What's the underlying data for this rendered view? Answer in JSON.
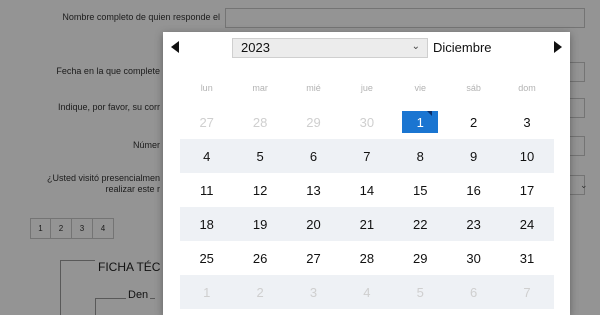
{
  "form": {
    "q1_label": "Nombre completo de quien responde el",
    "q2_label": "Fecha en la que complete",
    "q3_label": "Indique, por favor, su corr",
    "q4_label": "Númer",
    "q5_label_line1": "¿Usted visitó presencialmen",
    "q5_label_line2": "realizar este r",
    "tabs": [
      "1",
      "2",
      "3",
      "4"
    ],
    "ficha_title": "FICHA TÉC",
    "den_label": "Den"
  },
  "datepicker": {
    "year": "2023",
    "month": "Diciembre",
    "weekdays": [
      "lun",
      "mar",
      "mié",
      "jue",
      "vie",
      "sáb",
      "dom"
    ],
    "weeks": [
      [
        {
          "d": "27",
          "o": true
        },
        {
          "d": "28",
          "o": true
        },
        {
          "d": "29",
          "o": true
        },
        {
          "d": "30",
          "o": true
        },
        {
          "d": "1",
          "o": false,
          "sel": true
        },
        {
          "d": "2",
          "o": false
        },
        {
          "d": "3",
          "o": false
        }
      ],
      [
        {
          "d": "4",
          "o": false
        },
        {
          "d": "5",
          "o": false
        },
        {
          "d": "6",
          "o": false
        },
        {
          "d": "7",
          "o": false
        },
        {
          "d": "8",
          "o": false
        },
        {
          "d": "9",
          "o": false
        },
        {
          "d": "10",
          "o": false
        }
      ],
      [
        {
          "d": "11",
          "o": false
        },
        {
          "d": "12",
          "o": false
        },
        {
          "d": "13",
          "o": false
        },
        {
          "d": "14",
          "o": false
        },
        {
          "d": "15",
          "o": false
        },
        {
          "d": "16",
          "o": false
        },
        {
          "d": "17",
          "o": false
        }
      ],
      [
        {
          "d": "18",
          "o": false
        },
        {
          "d": "19",
          "o": false
        },
        {
          "d": "20",
          "o": false
        },
        {
          "d": "21",
          "o": false
        },
        {
          "d": "22",
          "o": false
        },
        {
          "d": "23",
          "o": false
        },
        {
          "d": "24",
          "o": false
        }
      ],
      [
        {
          "d": "25",
          "o": false
        },
        {
          "d": "26",
          "o": false
        },
        {
          "d": "27",
          "o": false
        },
        {
          "d": "28",
          "o": false
        },
        {
          "d": "29",
          "o": false
        },
        {
          "d": "30",
          "o": false
        },
        {
          "d": "31",
          "o": false
        }
      ],
      [
        {
          "d": "1",
          "o": true
        },
        {
          "d": "2",
          "o": true
        },
        {
          "d": "3",
          "o": true
        },
        {
          "d": "4",
          "o": true
        },
        {
          "d": "5",
          "o": true
        },
        {
          "d": "6",
          "o": true
        },
        {
          "d": "7",
          "o": true
        }
      ]
    ],
    "accent_color": "#1a75d1"
  },
  "icons": {
    "prev": "triangle-left-icon",
    "next": "triangle-right-icon",
    "year_dropdown": "chevron-down-icon"
  }
}
